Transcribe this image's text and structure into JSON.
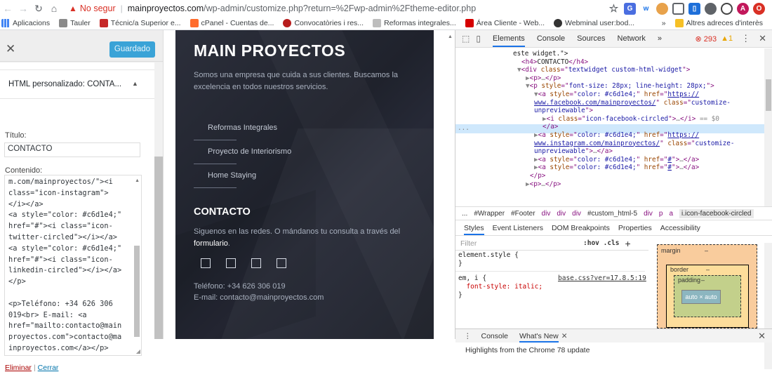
{
  "browser": {
    "security_label": "No segur",
    "url_host": "mainproyectos.com",
    "url_path": "/wp-admin/customize.php?return=%2Fwp-admin%2Ftheme-editor.php",
    "bookmarks": [
      {
        "label": "Aplicacions",
        "color": "#4285f4"
      },
      {
        "label": "Tauler",
        "color": "#8a8a8a"
      },
      {
        "label": "Técnic/a Superior e...",
        "color": "#c62828"
      },
      {
        "label": "cPanel - Cuentas de...",
        "color": "#ff6c2c"
      },
      {
        "label": "Convocatòries i res...",
        "color": "#b71c1c"
      },
      {
        "label": "Reformas integrales...",
        "color": "#bdbdbd"
      },
      {
        "label": "Área Cliente - Web...",
        "color": "#d50000"
      },
      {
        "label": "Webminal user:bod...",
        "color": "#333333"
      }
    ],
    "bookmarks_overflow": "»",
    "other_bookmarks": "Altres adreces d'interès"
  },
  "wp": {
    "saved_button": "Guardado",
    "widget_title": "HTML personalizado: CONTA...",
    "title_label": "Título:",
    "title_value": "CONTACTO",
    "content_label": "Contenido:",
    "code": "m.com/mainproyectos/\"><i\nclass=\"icon-instagram\">\n</i></a>\n<a style=\"color: #c6d1e4;\"\nhref=\"#\"><i class=\"icon-\ntwitter-circled\"></i></a>\n<a style=\"color: #c6d1e4;\"\nhref=\"#\"><i class=\"icon-\nlinkedin-circled\"></i></a>\n</p>\n\n<p>Teléfono: +34 626 306\n019<br> E-mail: <a\nhref=\"mailto:contacto@main\nproyectos.com\">contacto@ma\ninproyectos.com</a></p>",
    "delete_link": "Eliminar",
    "close_link": "Cerrar"
  },
  "site": {
    "title": "MAIN PROYECTOS",
    "tagline": "Somos una empresa que cuida a sus clientes. Buscamos la excelencia en todos nuestros servicios.",
    "menu": [
      "Reformas Integrales",
      "Proyecto de Interiorismo",
      "Home Staying"
    ],
    "contact_heading": "CONTACTO",
    "contact_text": "Siguenos en las redes. O mándanos tu consulta a través del",
    "contact_link": "formulario",
    "contact_end": ".",
    "social_icons": [
      "facebook-icon",
      "instagram-icon",
      "twitter-icon",
      "linkedin-icon"
    ],
    "phone": "Teléfono: +34 626 306 019",
    "email": "E-mail: contacto@mainproyectos.com"
  },
  "devtools": {
    "tabs": [
      "Elements",
      "Console",
      "Sources",
      "Network",
      "»"
    ],
    "active_tab": "Elements",
    "errors": "⊗ 293",
    "warnings": "▲1",
    "elements_lines": [
      {
        "indent": 13,
        "html": "<span class=\"txt\">este widget.\"></span>"
      },
      {
        "indent": 15,
        "html": "<span class=\"tag\">&lt;h4&gt;</span><span class=\"txt\">CONTACTO</span><span class=\"tag\">&lt;/h4&gt;</span>"
      },
      {
        "indent": 14,
        "html": "<span class=\"ell\">▼</span><span class=\"tag\">&lt;div </span><span class=\"attr\">class</span><span class=\"tag\">=\"</span><span class=\"val\">textwidget custom-html-widget</span><span class=\"tag\">\"&gt;</span>"
      },
      {
        "indent": 16,
        "html": "<span class=\"ell\">▶</span><span class=\"tag\">&lt;p&gt;</span><span class=\"ell\">…</span><span class=\"tag\">&lt;/p&gt;</span>"
      },
      {
        "indent": 16,
        "html": "<span class=\"ell\">▼</span><span class=\"tag\">&lt;p </span><span class=\"attr\">style</span><span class=\"tag\">=\"</span><span class=\"val\">font-size: 28px; line-height: 28px;</span><span class=\"tag\">\"&gt;</span>"
      },
      {
        "indent": 18,
        "html": "<span class=\"ell\">▼</span><span class=\"tag\">&lt;a </span><span class=\"attr\">style</span><span class=\"tag\">=\"</span><span class=\"val\">color: #c6d1e4;</span><span class=\"tag\">\" </span><span class=\"attr\">href</span><span class=\"tag\">=\"</span><span class=\"lnk\">https://</span>"
      },
      {
        "indent": 18,
        "html": "<span class=\"lnk\">www.facebook.com/mainproyectos/</span><span class=\"tag\">\" </span><span class=\"attr\">class</span><span class=\"tag\">=\"</span><span class=\"val\">customize-</span>"
      },
      {
        "indent": 18,
        "html": "<span class=\"val\">unpreviewable</span><span class=\"tag\">\"&gt;</span>"
      },
      {
        "indent": 20,
        "html": "<span class=\"ell\">▶</span><span class=\"tag\">&lt;i </span><span class=\"attr\">class</span><span class=\"tag\">=\"</span><span class=\"val\">icon-facebook-circled</span><span class=\"tag\">\"&gt;</span><span class=\"ell\">…</span><span class=\"tag\">&lt;/i&gt;</span><span class=\"ell\"> == $0</span>"
      },
      {
        "indent": 20,
        "html": "<span class=\"tag\">&lt;/a&gt;</span>"
      },
      {
        "indent": 18,
        "html": "<span class=\"ell\">▶</span><span class=\"tag\">&lt;a </span><span class=\"attr\">style</span><span class=\"tag\">=\"</span><span class=\"val\">color: #c6d1e4;</span><span class=\"tag\">\" </span><span class=\"attr\">href</span><span class=\"tag\">=\"</span><span class=\"lnk\">https://</span>"
      },
      {
        "indent": 18,
        "html": "<span class=\"lnk\">www.instagram.com/mainproyectos/</span><span class=\"tag\">\" </span><span class=\"attr\">class</span><span class=\"tag\">=\"</span><span class=\"val\">customize-</span>"
      },
      {
        "indent": 18,
        "html": "<span class=\"val\">unpreviewable</span><span class=\"tag\">\"&gt;</span><span class=\"ell\">…</span><span class=\"tag\">&lt;/a&gt;</span>"
      },
      {
        "indent": 18,
        "html": "<span class=\"ell\">▶</span><span class=\"tag\">&lt;a </span><span class=\"attr\">style</span><span class=\"tag\">=\"</span><span class=\"val\">color: #c6d1e4;</span><span class=\"tag\">\" </span><span class=\"attr\">href</span><span class=\"tag\">=\"</span><span class=\"lnk\">#</span><span class=\"tag\">\"&gt;</span><span class=\"ell\">…</span><span class=\"tag\">&lt;/a&gt;</span>"
      },
      {
        "indent": 18,
        "html": "<span class=\"ell\">▶</span><span class=\"tag\">&lt;a </span><span class=\"attr\">style</span><span class=\"tag\">=\"</span><span class=\"val\">color: #c6d1e4;</span><span class=\"tag\">\" </span><span class=\"attr\">href</span><span class=\"tag\">=\"</span><span class=\"lnk\">#</span><span class=\"tag\">\"&gt;</span><span class=\"ell\">…</span><span class=\"tag\">&lt;/a&gt;</span>"
      },
      {
        "indent": 17,
        "html": "<span class=\"tag\">&lt;/p&gt;</span>"
      },
      {
        "indent": 16,
        "html": "<span class=\"ell\">▶</span><span class=\"tag\">&lt;p&gt;</span><span class=\"ell\">…</span><span class=\"tag\">&lt;/p&gt;</span>"
      }
    ],
    "dots": "...",
    "breadcrumbs": [
      "...",
      "#Wrapper",
      "#Footer",
      "div",
      "div",
      "div",
      "#custom_html-5",
      "div",
      "p",
      "a",
      "i.icon-facebook-circled"
    ],
    "styles_tabs": [
      "Styles",
      "Event Listeners",
      "DOM Breakpoints",
      "Properties",
      "Accessibility"
    ],
    "filter_placeholder": "Filter",
    "hov_cls": ":hov  .cls",
    "rules": [
      {
        "line": "element.style {"
      },
      {
        "line": "}"
      },
      {
        "line": "em, i {"
      },
      {
        "line": "  font-style: italic;"
      },
      {
        "line": "}"
      }
    ],
    "rule_source": "base.css?ver=17.8.5:19",
    "boxmodel": {
      "margin": "margin",
      "border": "border",
      "padding": "padding",
      "content": "auto × auto",
      "dash": "–"
    },
    "drawer_tabs": [
      "Console",
      "What's New"
    ],
    "whats_new": "Highlights from the Chrome 78 update"
  }
}
